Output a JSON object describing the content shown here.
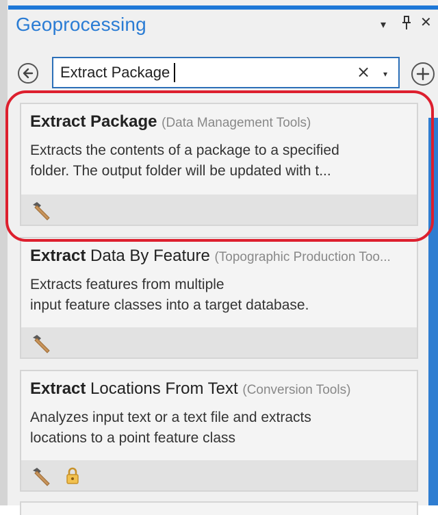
{
  "panel": {
    "title": "Geoprocessing",
    "controls": {
      "options": "▾",
      "pin": "⊥",
      "close": "✕"
    }
  },
  "search": {
    "value": "Extract Package",
    "clear": "×",
    "dropdown": "▾"
  },
  "nav": {
    "back_icon": "arrow-left-circle-icon",
    "add_icon": "plus-circle-icon"
  },
  "results": [
    {
      "bold": "Extract Package",
      "rest": "",
      "toolbox": "(Data Management Tools)",
      "desc_lines": [
        "Extracts the contents of a package to a specified",
        "folder. The output folder will be  updated with t..."
      ],
      "icons": [
        "hammer-icon"
      ],
      "highlighted": true
    },
    {
      "bold": "Extract",
      "rest": " Data By Feature",
      "toolbox": "(Topographic Production Too...",
      "desc_lines": [
        "Extracts features from multiple",
        "input feature classes into a target database."
      ],
      "icons": [
        "hammer-icon"
      ]
    },
    {
      "bold": "Extract",
      "rest": " Locations From Text",
      "toolbox": "(Conversion Tools)",
      "desc_lines": [
        "Analyzes input text or a text file and extracts",
        "locations to a point feature class"
      ],
      "icons": [
        "hammer-icon",
        "lock-icon"
      ]
    }
  ],
  "colors": {
    "accent": "#1e78d7",
    "title": "#2a7cd4",
    "highlight": "#dd1f2e"
  }
}
